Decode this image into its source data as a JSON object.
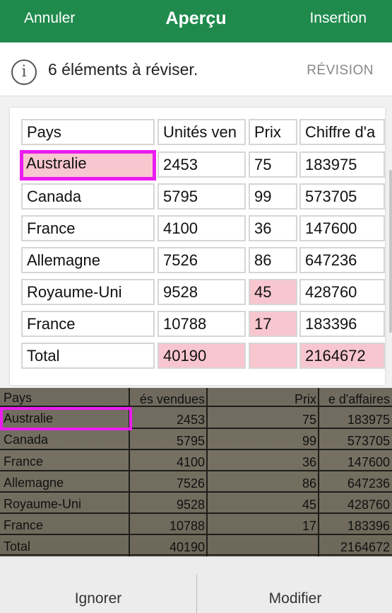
{
  "header": {
    "cancel_label": "Annuler",
    "title": "Aperçu",
    "insert_label": "Insertion",
    "background": "#1f8a4c"
  },
  "infobar": {
    "icon": "info-icon",
    "message": "6 éléments à réviser.",
    "review_label": "RÉVISION"
  },
  "preview_table": {
    "highlight_color": "#f8c6cf",
    "selection_color": "#ea1cf0",
    "headers": [
      "Pays",
      "Unités ven",
      "Prix",
      "Chiffre d'a"
    ],
    "rows": [
      [
        "Australie",
        "2453",
        "75",
        "183975"
      ],
      [
        "Canada",
        "5795",
        "99",
        "573705"
      ],
      [
        "France",
        "4100",
        "36",
        "147600"
      ],
      [
        "Allemagne",
        "7526",
        "86",
        "647236"
      ],
      [
        "Royaume-Uni",
        "9528",
        "45",
        "428760"
      ],
      [
        "France",
        "10788",
        "17",
        "183396"
      ],
      [
        "Total",
        "40190",
        "",
        "2164672"
      ]
    ]
  },
  "photo": {
    "headers": [
      "Pays",
      "és vendues",
      "Prix",
      "e d'affaires"
    ],
    "rows": [
      [
        "Australie",
        "2453",
        "75",
        "183975"
      ],
      [
        "Canada",
        "5795",
        "99",
        "573705"
      ],
      [
        "France",
        "4100",
        "36",
        "147600"
      ],
      [
        "Allemagne",
        "7526",
        "86",
        "647236"
      ],
      [
        "Royaume-Uni",
        "9528",
        "45",
        "428760"
      ],
      [
        "France",
        "10788",
        "17",
        "183396"
      ],
      [
        "Total",
        "40190",
        "",
        "2164672"
      ]
    ]
  },
  "footer": {
    "ignore_label": "Ignorer",
    "edit_label": "Modifier"
  }
}
